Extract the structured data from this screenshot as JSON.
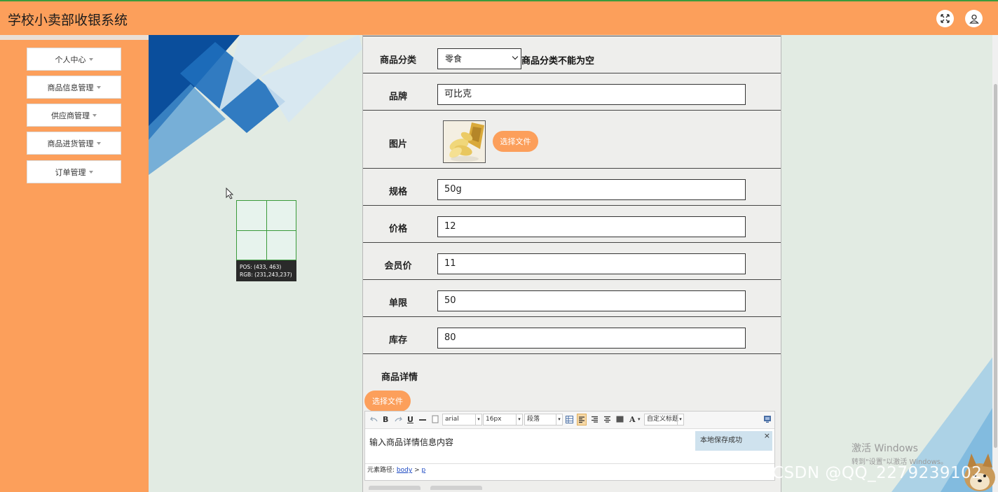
{
  "app": {
    "title": "学校小卖部收银系统"
  },
  "header": {
    "fullscreen_icon": "fullscreen-icon",
    "user_icon": "user-icon"
  },
  "sidebar": {
    "items": [
      {
        "label": "个人中心"
      },
      {
        "label": "商品信息管理"
      },
      {
        "label": "供应商管理"
      },
      {
        "label": "商品进货管理"
      },
      {
        "label": "订单管理"
      }
    ]
  },
  "form": {
    "category": {
      "label": "商品分类",
      "value": "零食",
      "hint": "商品分类不能为空"
    },
    "brand": {
      "label": "品牌",
      "value": "可比克"
    },
    "image": {
      "label": "图片",
      "button": "选择文件"
    },
    "spec": {
      "label": "规格",
      "value": "50g"
    },
    "price": {
      "label": "价格",
      "value": "12"
    },
    "member_price": {
      "label": "会员价",
      "value": "11"
    },
    "limit": {
      "label": "单限",
      "value": "50"
    },
    "stock": {
      "label": "库存",
      "value": "80"
    },
    "details": {
      "label": "商品详情",
      "button": "选择文件"
    }
  },
  "editor": {
    "toolbar": {
      "bold": "B",
      "underline": "U",
      "font_family": "arial",
      "font_size": "16px",
      "paragraph": "段落",
      "font_color": "A",
      "custom_title": "自定义标题"
    },
    "content": "输入商品详情信息内容",
    "toast": "本地保存成功",
    "toast_close": "×",
    "path_label": "元素路径:",
    "path_body": "body",
    "path_sep": ">",
    "path_p": "p"
  },
  "magnifier": {
    "pos": "POS:  (433, 463)",
    "rgb": "RGB:  (231,243,237)"
  },
  "watermarks": {
    "activate": "激活 Windows",
    "activate_sub": "转到\"设置\"以激活 Windows。",
    "csdn": "CSDN @QQ_2279239102"
  },
  "colors": {
    "accent": "#fc9f5b",
    "background": "#e2ebe3",
    "panel": "#eeeeec"
  }
}
